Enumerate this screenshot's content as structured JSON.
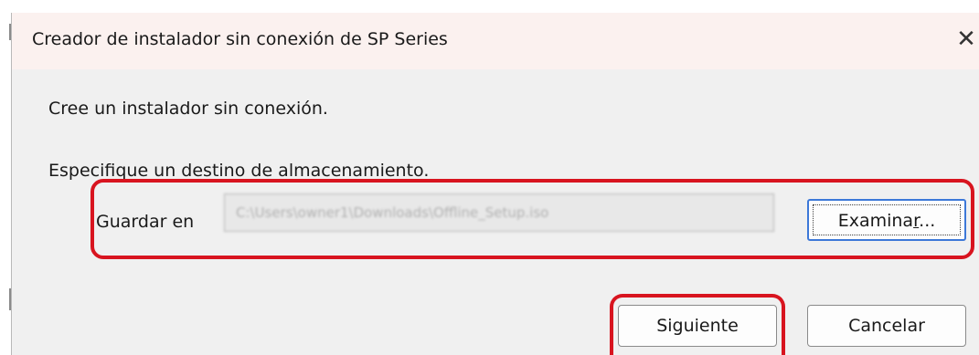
{
  "dialog": {
    "title": "Creador de instalador sin conexión de SP Series",
    "close_symbol": "✕",
    "instruction_1": "Cree un instalador sin conexión.",
    "instruction_2": "Especifique un destino de almacenamiento.",
    "save_label": "Guardar en",
    "save_path": "C:\\Users\\owner1\\Downloads\\Offline_Setup.iso",
    "browse_label_prefix": "Examina",
    "browse_label_accel": "r",
    "browse_label_suffix": "...",
    "next_label": "Siguiente",
    "cancel_label": "Cancelar"
  },
  "icons": {
    "close": "close-icon"
  },
  "colors": {
    "highlight": "#d8141f",
    "dialog_bg": "#f0f0f0",
    "titlebar_bg": "#fbf1ef",
    "focus_border": "#3c78d8"
  }
}
